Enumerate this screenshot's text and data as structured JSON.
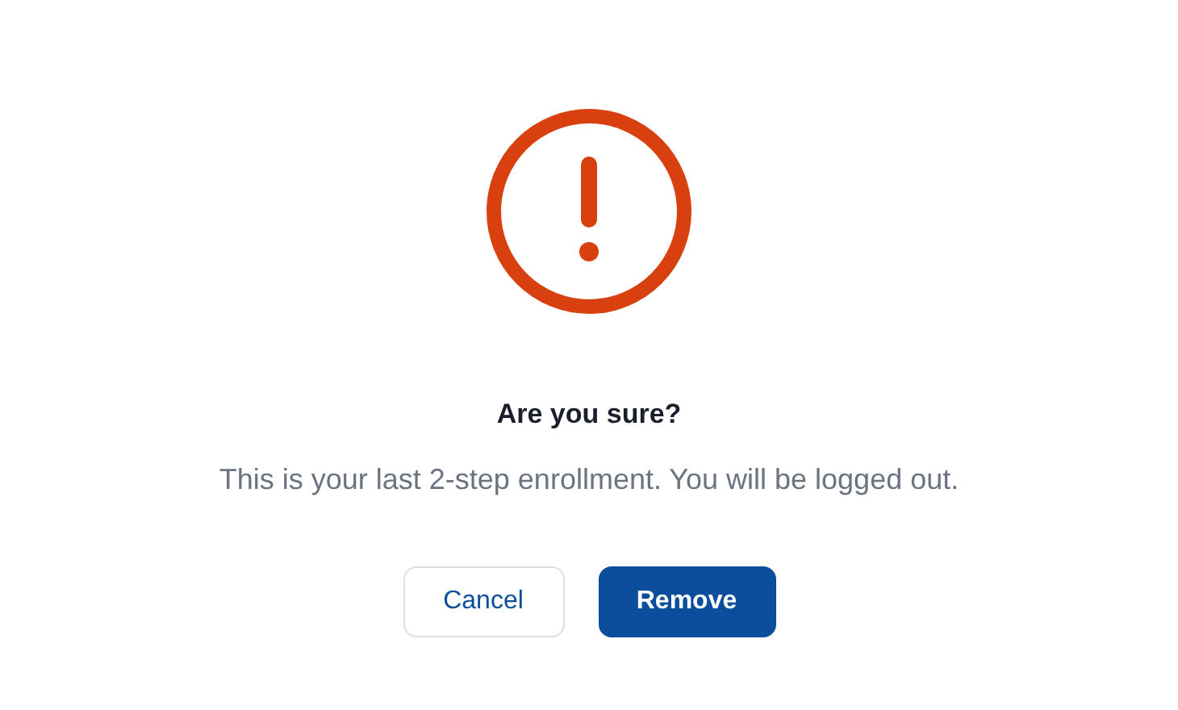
{
  "dialog": {
    "title": "Are you sure?",
    "message": "This is your last 2-step enrollment. You will be logged out.",
    "buttons": [
      {
        "label": "Cancel",
        "kind": "secondary"
      },
      {
        "label": "Remove",
        "kind": "primary"
      }
    ]
  }
}
